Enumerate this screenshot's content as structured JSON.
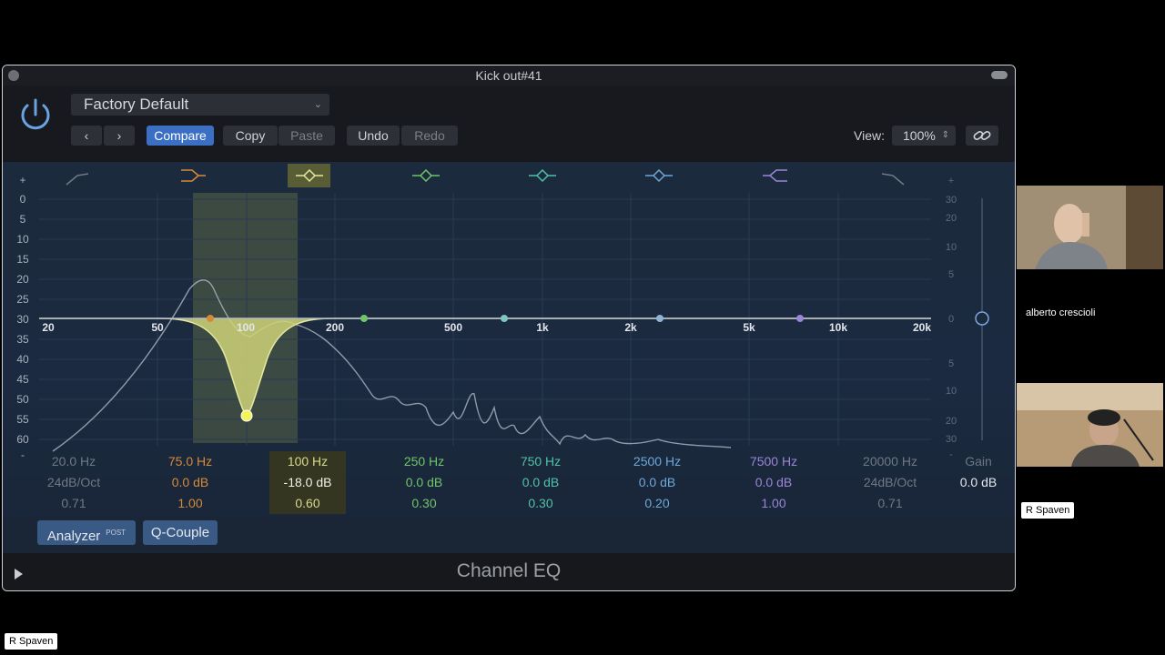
{
  "window": {
    "title": "Kick out#41"
  },
  "toolbar": {
    "preset": "Factory Default",
    "compare": "Compare",
    "copy": "Copy",
    "paste": "Paste",
    "undo": "Undo",
    "redo": "Redo",
    "view_label": "View:",
    "view_value": "100%"
  },
  "graph": {
    "db_labels": [
      "+",
      "0",
      "5",
      "10",
      "15",
      "20",
      "25",
      "30",
      "35",
      "40",
      "45",
      "50",
      "55",
      "60",
      "-"
    ],
    "freq_labels": [
      "20",
      "50",
      "100",
      "200",
      "500",
      "1k",
      "2k",
      "5k",
      "10k",
      "20k"
    ],
    "gain_scale": [
      "+",
      "30",
      "20",
      "10",
      "5",
      "0",
      "5",
      "10",
      "20",
      "30",
      "-"
    ]
  },
  "bands": [
    {
      "freq": "20.0 Hz",
      "gain": "24dB/Oct",
      "q": "0.71",
      "color": "#6f7884",
      "selected": false
    },
    {
      "freq": "75.0 Hz",
      "gain": "0.0 dB",
      "q": "1.00",
      "color": "#d58a3a",
      "selected": false
    },
    {
      "freq": "100 Hz",
      "gain": "-18.0 dB",
      "q": "0.60",
      "color": "#d7d98a",
      "selected": true
    },
    {
      "freq": "250 Hz",
      "gain": "0.0 dB",
      "q": "0.30",
      "color": "#6fc56a",
      "selected": false
    },
    {
      "freq": "750 Hz",
      "gain": "0.0 dB",
      "q": "0.30",
      "color": "#4fc2a6",
      "selected": false
    },
    {
      "freq": "2500 Hz",
      "gain": "0.0 dB",
      "q": "0.20",
      "color": "#6ea8d8",
      "selected": false
    },
    {
      "freq": "7500 Hz",
      "gain": "0.0 dB",
      "q": "1.00",
      "color": "#9a86d8",
      "selected": false
    },
    {
      "freq": "20000 Hz",
      "gain": "24dB/Oct",
      "q": "0.71",
      "color": "#6f7884",
      "selected": false
    }
  ],
  "output": {
    "label": "Gain",
    "value": "0.0 dB"
  },
  "bottom": {
    "analyzer": "Analyzer",
    "analyzer_mode": "POST",
    "q_couple": "Q-Couple"
  },
  "footer": {
    "plugin_name": "Channel EQ"
  },
  "participants": {
    "p1_name": "alberto crescioli",
    "p2_name": "R Spaven",
    "bottom_name": "R Spaven"
  }
}
